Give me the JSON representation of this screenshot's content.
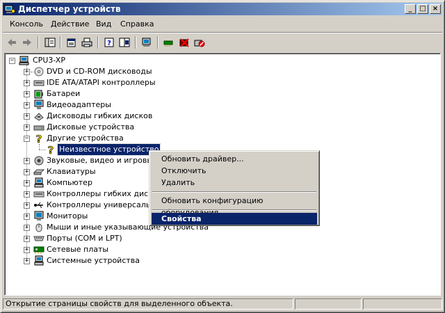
{
  "window": {
    "title": "Диспетчер устройств"
  },
  "titlebar_buttons": {
    "minimize": "_",
    "maximize": "□",
    "close": "×"
  },
  "menu": [
    "Консоль",
    "Действие",
    "Вид",
    "Справка"
  ],
  "toolbar": [
    "back-arrow-icon",
    "forward-arrow-icon",
    "show-hide-tree-icon",
    "properties-icon",
    "print-icon",
    "help-icon",
    "console-tree-icon",
    "scan-hardware-icon",
    "update-driver-icon",
    "uninstall-icon",
    "disable-icon"
  ],
  "tree": {
    "root": "CPU3-XP",
    "items": [
      "DVD и CD-ROM дисководы",
      "IDE ATA/ATAPI контроллеры",
      "Батареи",
      "Видеоадаптеры",
      "Дисководы гибких дисков",
      "Дисковые устройства",
      "Другие устройства",
      "Неизвестное устройство",
      "Звуковые, видео и игровые",
      "Клавиатуры",
      "Компьютер",
      "Контроллеры гибких дисков",
      "Контроллеры универсальной",
      "Мониторы",
      "Мыши и иные указывающие устройства",
      "Порты (COM и LPT)",
      "Сетевые платы",
      "Системные устройства"
    ]
  },
  "context_menu": {
    "update_driver": "Обновить драйвер...",
    "disable": "Отключить",
    "remove": "Удалить",
    "scan": "Обновить конфигурацию оборудования",
    "properties": "Свойства"
  },
  "status": {
    "text": "Открытие страницы свойств для выделенного объекта."
  },
  "colors": {
    "title_start": "#0a246a",
    "title_end": "#a6caf0",
    "selection": "#0a246a",
    "face": "#d4d0c8"
  }
}
